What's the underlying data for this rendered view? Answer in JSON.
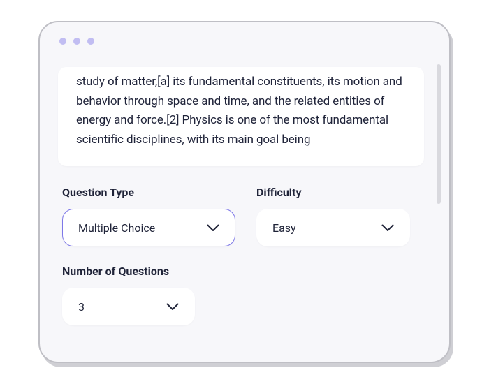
{
  "colors": {
    "accent": "#7e78e8",
    "dot": "#c1bdf2",
    "text": "#1f2338"
  },
  "card": {
    "text": "study of matter,[a] its fundamental constituents, its motion and behavior through  space and time, and the related entities of energy and force.[2] Physics is one of the most fundamental scientific disciplines, with its main goal being"
  },
  "fields": {
    "questionType": {
      "label": "Question Type",
      "value": "Multiple Choice"
    },
    "difficulty": {
      "label": "Difficulty",
      "value": "Easy"
    },
    "count": {
      "label": "Number of Questions",
      "value": "3"
    }
  }
}
